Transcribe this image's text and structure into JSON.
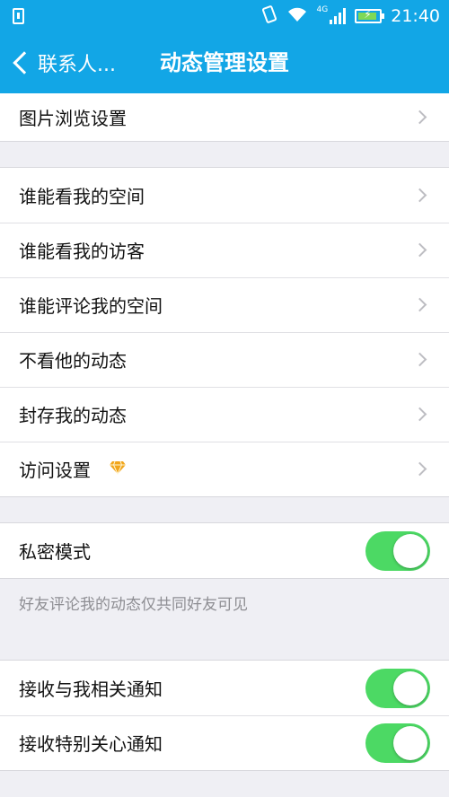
{
  "status_bar": {
    "network": "4G",
    "time": "21:40",
    "battery_level": 0.9
  },
  "nav": {
    "back_label": "联系人...",
    "title": "动态管理设置"
  },
  "section1": {
    "items": [
      {
        "label": "图片浏览设置"
      }
    ]
  },
  "section2": {
    "items": [
      {
        "label": "谁能看我的空间"
      },
      {
        "label": "谁能看我的访客"
      },
      {
        "label": "谁能评论我的空间"
      },
      {
        "label": "不看他的动态"
      },
      {
        "label": "封存我的动态"
      },
      {
        "label": "访问设置"
      }
    ]
  },
  "section3": {
    "private_mode": {
      "label": "私密模式",
      "enabled": true
    },
    "note": "好友评论我的动态仅共同好友可见"
  },
  "section4": {
    "items": [
      {
        "label": "接收与我相关通知",
        "enabled": true
      },
      {
        "label": "接收特别关心通知",
        "enabled": true
      }
    ]
  },
  "colors": {
    "header": "#12a6e6",
    "toggle_on": "#4cd964",
    "vip_diamond": "#f1a51b"
  }
}
